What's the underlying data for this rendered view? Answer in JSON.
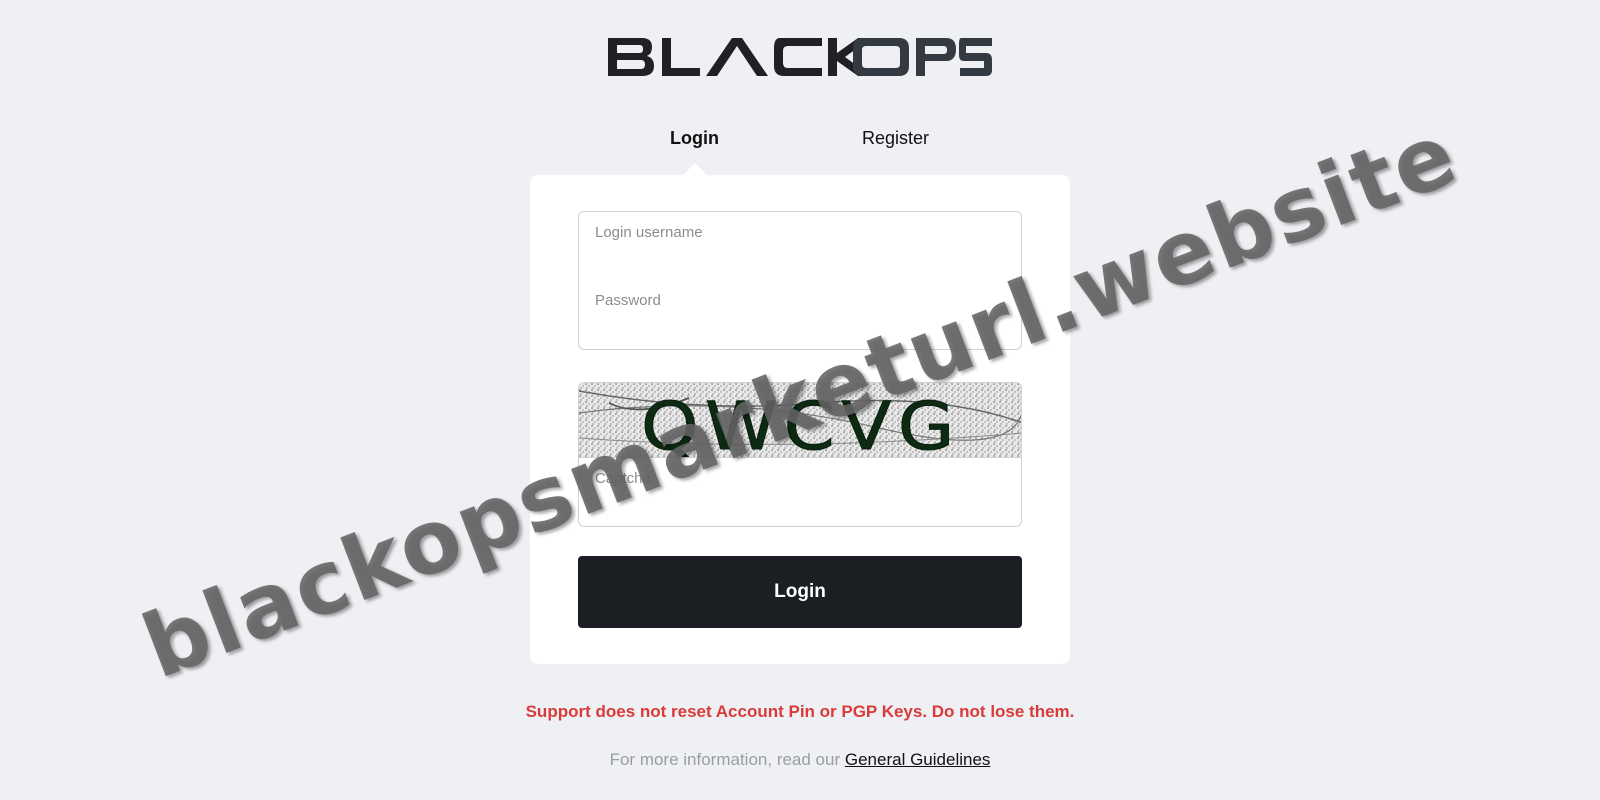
{
  "brand": {
    "logo_text": "BLACK OPS"
  },
  "tabs": {
    "login": "Login",
    "register": "Register"
  },
  "form": {
    "username_placeholder": "Login username",
    "password_placeholder": "Password",
    "captcha_placeholder": "Captcha",
    "captcha_code": "QWCVG",
    "submit_label": "Login"
  },
  "notices": {
    "warning": "Support does not reset Account Pin or PGP Keys. Do not lose them.",
    "info_prefix": "For more information, read our",
    "guidelines_link": "General Guidelines"
  },
  "watermark": {
    "text": "blackopsmarketurl.website"
  },
  "colors": {
    "background": "#eff0f4",
    "button": "#1b1f24",
    "warning": "#d93a3a"
  }
}
